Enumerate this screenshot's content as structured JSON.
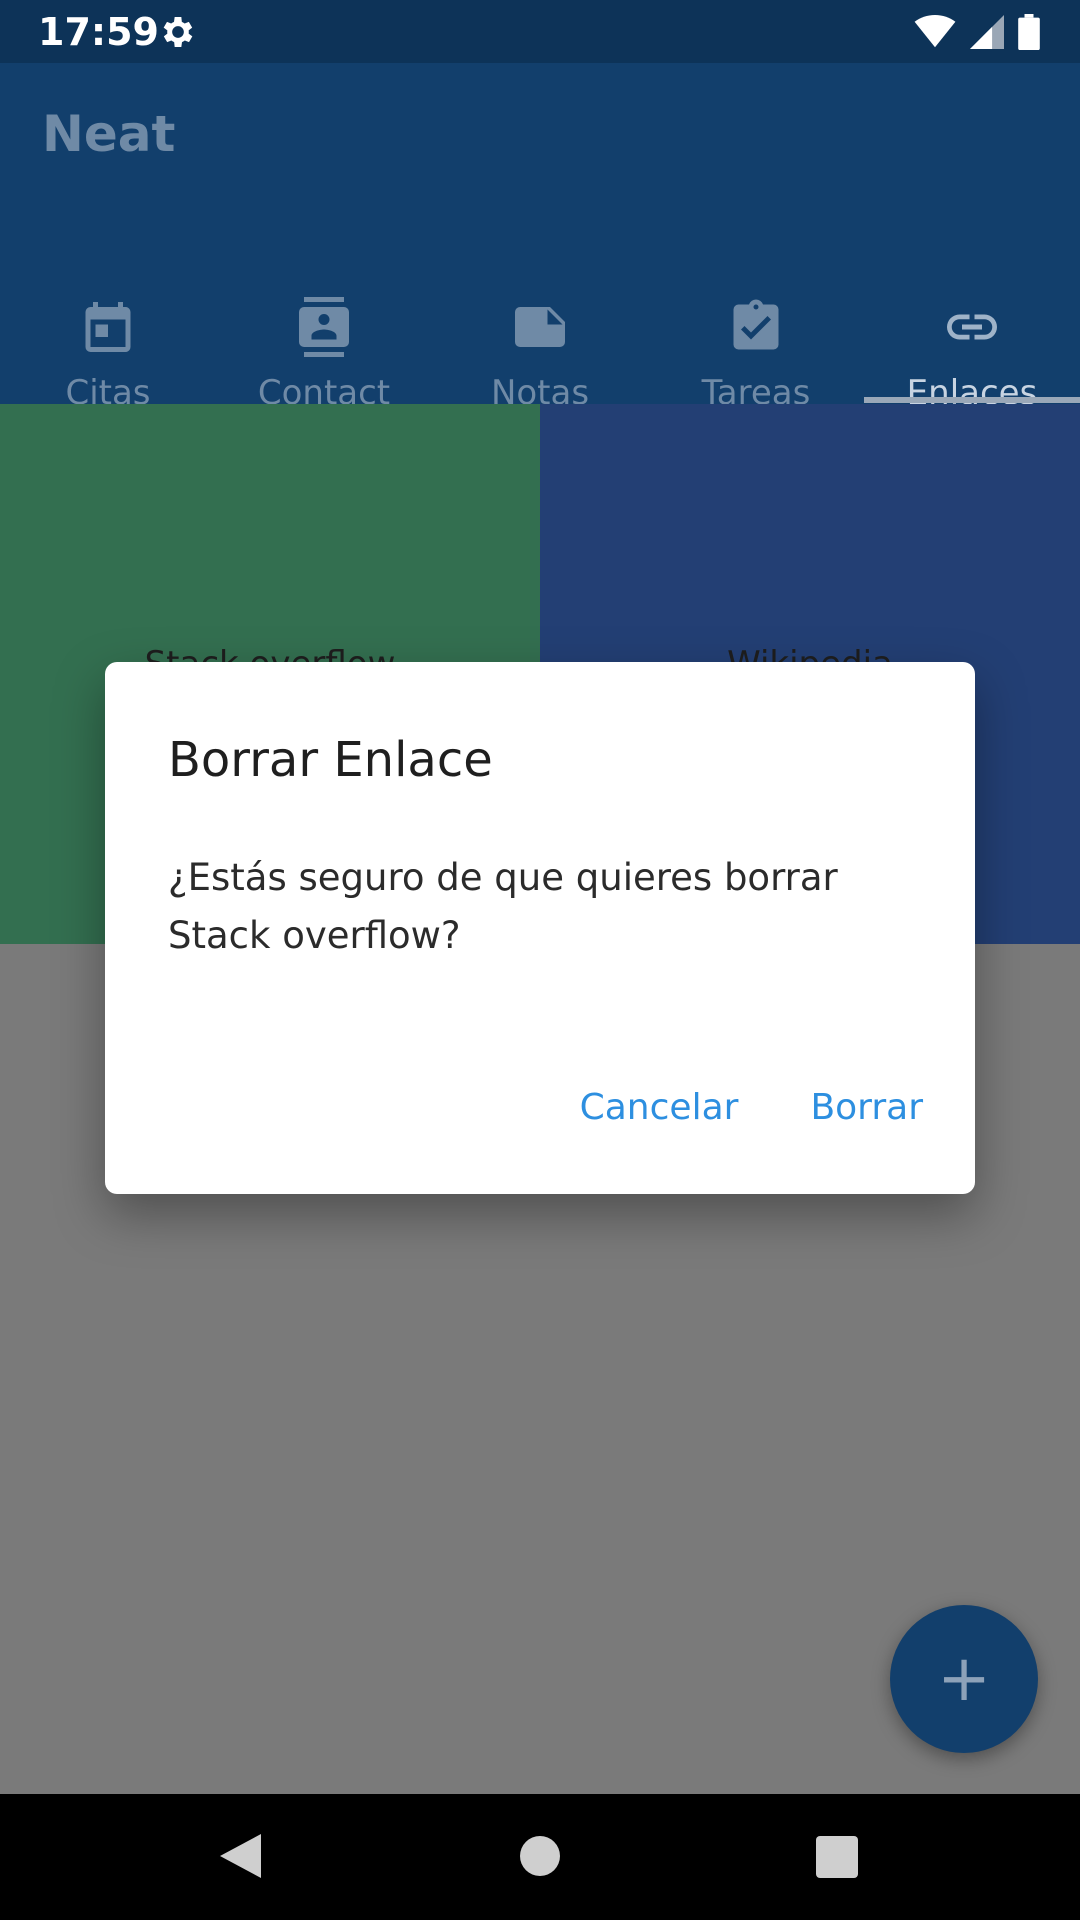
{
  "status_bar": {
    "time": "17:59",
    "icons": [
      "gear-icon",
      "wifi-icon",
      "signal-icon",
      "battery-icon"
    ]
  },
  "app": {
    "title": "Neat"
  },
  "tabs": [
    {
      "label": "Citas",
      "icon": "calendar-icon"
    },
    {
      "label": "Contact",
      "icon": "contact-card-icon"
    },
    {
      "label": "Notas",
      "icon": "note-icon"
    },
    {
      "label": "Tareas",
      "icon": "clipboard-check-icon"
    },
    {
      "label": "Enlaces",
      "icon": "link-icon",
      "active": true
    }
  ],
  "tiles": [
    {
      "label": "Stack overflow",
      "color": "#336f50"
    },
    {
      "label": "Wikipedia",
      "color": "#233f74"
    }
  ],
  "dialog": {
    "title": "Borrar Enlace",
    "message": "¿Estás seguro de que quieres borrar Stack overflow?",
    "cancel_label": "Cancelar",
    "confirm_label": "Borrar"
  },
  "fab": {
    "label": "+",
    "icon": "plus-icon"
  },
  "colors": {
    "accent": "#2d8fe0",
    "appbar": "#123f6c",
    "status_bar": "#0d3358"
  }
}
